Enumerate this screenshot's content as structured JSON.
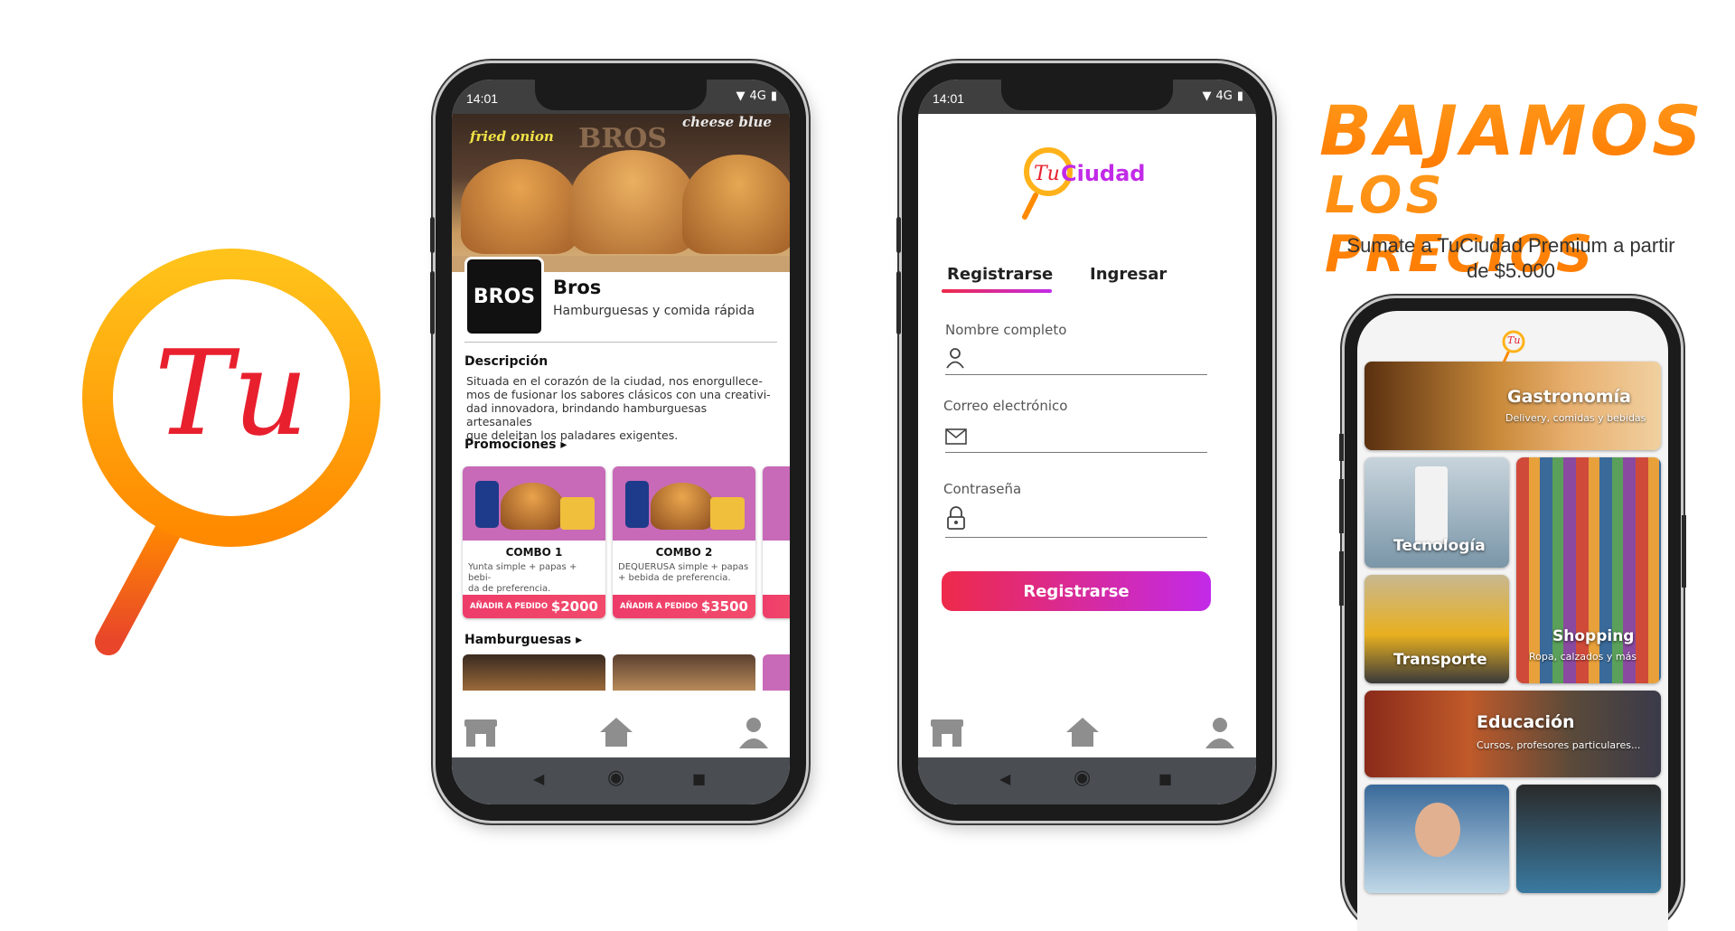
{
  "logo": {
    "mark_text": "Tu"
  },
  "phone1": {
    "status": {
      "time": "14:01",
      "network": "4G"
    },
    "hero": {
      "left_label": "fried onion",
      "middle_label": "BROS",
      "right_label": "cheese blue"
    },
    "business": {
      "logo_text": "BROS",
      "name": "Bros",
      "subtitle": "Hamburguesas y comida rápida"
    },
    "description": {
      "title": "Descripción",
      "lines": [
        "Situada en el corazón de la ciudad, nos enorgullece-",
        "mos de fusionar los sabores clásicos con una creativi-",
        "dad innovadora, brindando hamburguesas artesanales",
        "que deleitan los paladares exigentes."
      ]
    },
    "promotions": {
      "title": "Promociones ▸",
      "items": [
        {
          "name": "COMBO 1",
          "desc_l1": "Yunta simple + papas + bebi-",
          "desc_l2": "da de preferencia.",
          "action": "AÑADIR A PEDIDO",
          "price": "$2000"
        },
        {
          "name": "COMBO 2",
          "desc_l1": "DEQUERUSA simple + papas",
          "desc_l2": "+ bebida de preferencia.",
          "action": "AÑADIR A PEDIDO",
          "price": "$3500"
        }
      ]
    },
    "burgers": {
      "title": "Hamburguesas ▸"
    }
  },
  "phone2": {
    "status": {
      "time": "14:01",
      "network": "4G"
    },
    "brand": {
      "tu": "Tu",
      "ciudad": "Ciudad"
    },
    "tabs": {
      "register": "Registrarse",
      "login": "Ingresar"
    },
    "fields": {
      "name_label": "Nombre completo",
      "email_label": "Correo electrónico",
      "password_label": "Contraseña"
    },
    "submit_label": "Registrarse"
  },
  "promo": {
    "headline_1": "BAJAMOS",
    "headline_2": "LOS PRECIOS",
    "sub_1": "Sumate a TuCiudad Premium a partir",
    "sub_2": "de $5.000",
    "logo_text": "Tu",
    "categories": [
      {
        "title": "Gastronomía",
        "subtitle": "Delivery, comidas y bebidas"
      },
      {
        "title": "Tecnología"
      },
      {
        "title": "Transporte"
      },
      {
        "title": "Shopping",
        "subtitle": "Ropa, calzados y más"
      },
      {
        "title": "Educación",
        "subtitle": "Cursos, profesores particulares..."
      }
    ]
  },
  "colors": {
    "accent_red": "#ee2a4a",
    "accent_purple": "#c22ae8",
    "orange": "#ff8a00",
    "price_bar": "#ef3f6a"
  }
}
